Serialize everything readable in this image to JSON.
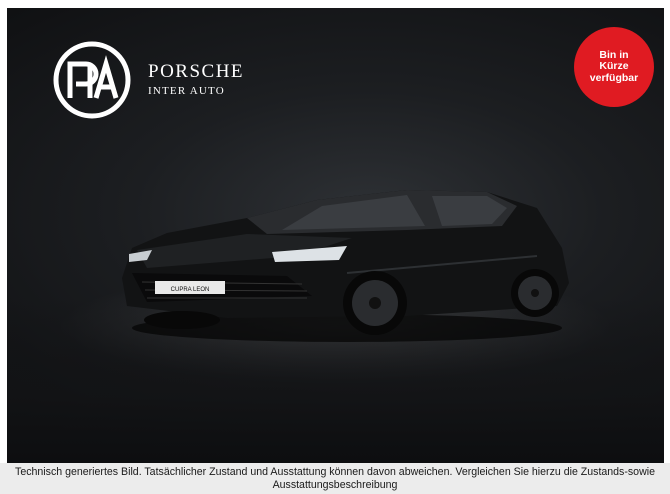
{
  "dealer": {
    "logo_initials": "PIA",
    "name": "PORSCHE",
    "subtitle": "INTER AUTO"
  },
  "badge": {
    "text": "Bin in Kürze verfügbar",
    "color": "#e01b22"
  },
  "vehicle": {
    "license_plate": "CUPRA LEON",
    "color": "black"
  },
  "disclaimer": {
    "text": "Technisch generiertes Bild. Tatsächlicher Zustand und Ausstattung können davon abweichen. Vergleichen Sie hierzu die Zustands-sowie Ausstattungsbeschreibung"
  }
}
